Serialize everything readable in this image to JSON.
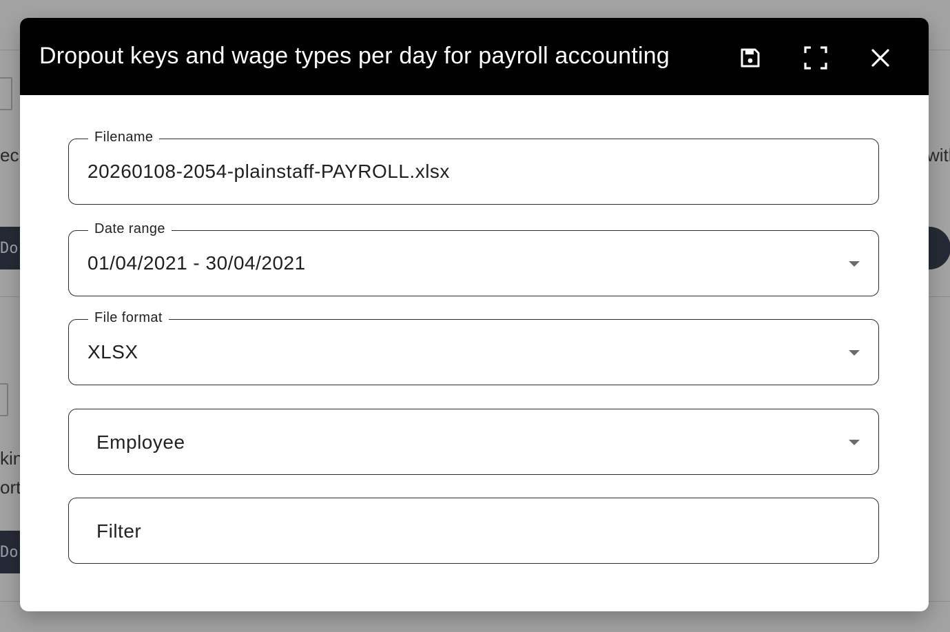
{
  "background": {
    "fragments": [
      "ec",
      "Do",
      "kin",
      "ort",
      "Do",
      "with"
    ]
  },
  "dialog": {
    "title": "Dropout keys and wage types per day for payroll accounting",
    "header_icons": [
      "save-icon",
      "fullscreen-icon",
      "close-icon"
    ],
    "fields": {
      "filename": {
        "label": "Filename",
        "value": "20260108-2054-plainstaff-PAYROLL.xlsx"
      },
      "date_range": {
        "label": "Date range",
        "value": "01/04/2021 - 30/04/2021"
      },
      "file_format": {
        "label": "File format",
        "value": "XLSX"
      },
      "employee": {
        "placeholder": "Employee"
      },
      "filter": {
        "placeholder": "Filter"
      }
    }
  },
  "colors": {
    "header_bg": "#000000",
    "header_text": "#ffffff",
    "field_border": "#2b2b2b"
  }
}
